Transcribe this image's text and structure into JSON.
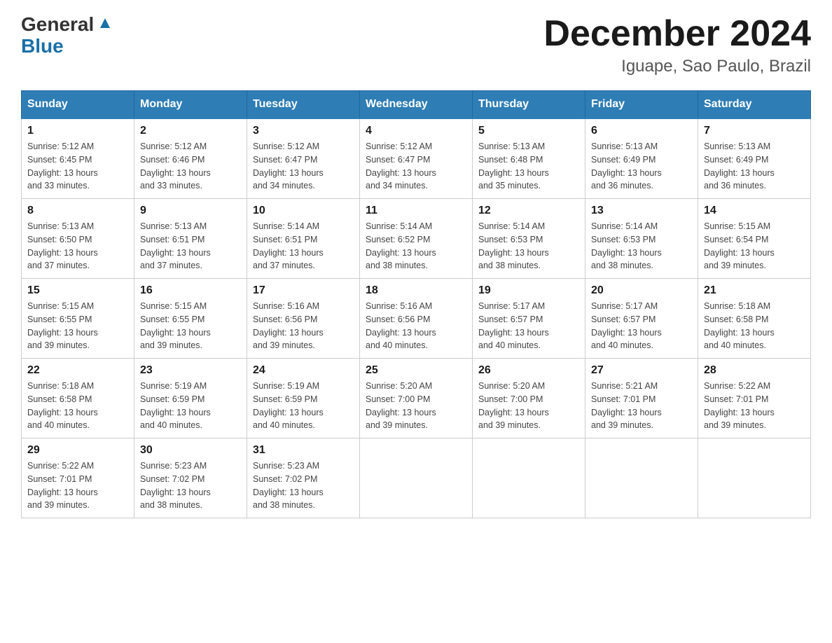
{
  "logo": {
    "line1": "General",
    "line2": "Blue"
  },
  "header": {
    "month_year": "December 2024",
    "location": "Iguape, Sao Paulo, Brazil"
  },
  "days_of_week": [
    "Sunday",
    "Monday",
    "Tuesday",
    "Wednesday",
    "Thursday",
    "Friday",
    "Saturday"
  ],
  "weeks": [
    [
      {
        "day": "1",
        "sunrise": "5:12 AM",
        "sunset": "6:45 PM",
        "daylight": "13 hours and 33 minutes."
      },
      {
        "day": "2",
        "sunrise": "5:12 AM",
        "sunset": "6:46 PM",
        "daylight": "13 hours and 33 minutes."
      },
      {
        "day": "3",
        "sunrise": "5:12 AM",
        "sunset": "6:47 PM",
        "daylight": "13 hours and 34 minutes."
      },
      {
        "day": "4",
        "sunrise": "5:12 AM",
        "sunset": "6:47 PM",
        "daylight": "13 hours and 34 minutes."
      },
      {
        "day": "5",
        "sunrise": "5:13 AM",
        "sunset": "6:48 PM",
        "daylight": "13 hours and 35 minutes."
      },
      {
        "day": "6",
        "sunrise": "5:13 AM",
        "sunset": "6:49 PM",
        "daylight": "13 hours and 36 minutes."
      },
      {
        "day": "7",
        "sunrise": "5:13 AM",
        "sunset": "6:49 PM",
        "daylight": "13 hours and 36 minutes."
      }
    ],
    [
      {
        "day": "8",
        "sunrise": "5:13 AM",
        "sunset": "6:50 PM",
        "daylight": "13 hours and 37 minutes."
      },
      {
        "day": "9",
        "sunrise": "5:13 AM",
        "sunset": "6:51 PM",
        "daylight": "13 hours and 37 minutes."
      },
      {
        "day": "10",
        "sunrise": "5:14 AM",
        "sunset": "6:51 PM",
        "daylight": "13 hours and 37 minutes."
      },
      {
        "day": "11",
        "sunrise": "5:14 AM",
        "sunset": "6:52 PM",
        "daylight": "13 hours and 38 minutes."
      },
      {
        "day": "12",
        "sunrise": "5:14 AM",
        "sunset": "6:53 PM",
        "daylight": "13 hours and 38 minutes."
      },
      {
        "day": "13",
        "sunrise": "5:14 AM",
        "sunset": "6:53 PM",
        "daylight": "13 hours and 38 minutes."
      },
      {
        "day": "14",
        "sunrise": "5:15 AM",
        "sunset": "6:54 PM",
        "daylight": "13 hours and 39 minutes."
      }
    ],
    [
      {
        "day": "15",
        "sunrise": "5:15 AM",
        "sunset": "6:55 PM",
        "daylight": "13 hours and 39 minutes."
      },
      {
        "day": "16",
        "sunrise": "5:15 AM",
        "sunset": "6:55 PM",
        "daylight": "13 hours and 39 minutes."
      },
      {
        "day": "17",
        "sunrise": "5:16 AM",
        "sunset": "6:56 PM",
        "daylight": "13 hours and 39 minutes."
      },
      {
        "day": "18",
        "sunrise": "5:16 AM",
        "sunset": "6:56 PM",
        "daylight": "13 hours and 40 minutes."
      },
      {
        "day": "19",
        "sunrise": "5:17 AM",
        "sunset": "6:57 PM",
        "daylight": "13 hours and 40 minutes."
      },
      {
        "day": "20",
        "sunrise": "5:17 AM",
        "sunset": "6:57 PM",
        "daylight": "13 hours and 40 minutes."
      },
      {
        "day": "21",
        "sunrise": "5:18 AM",
        "sunset": "6:58 PM",
        "daylight": "13 hours and 40 minutes."
      }
    ],
    [
      {
        "day": "22",
        "sunrise": "5:18 AM",
        "sunset": "6:58 PM",
        "daylight": "13 hours and 40 minutes."
      },
      {
        "day": "23",
        "sunrise": "5:19 AM",
        "sunset": "6:59 PM",
        "daylight": "13 hours and 40 minutes."
      },
      {
        "day": "24",
        "sunrise": "5:19 AM",
        "sunset": "6:59 PM",
        "daylight": "13 hours and 40 minutes."
      },
      {
        "day": "25",
        "sunrise": "5:20 AM",
        "sunset": "7:00 PM",
        "daylight": "13 hours and 39 minutes."
      },
      {
        "day": "26",
        "sunrise": "5:20 AM",
        "sunset": "7:00 PM",
        "daylight": "13 hours and 39 minutes."
      },
      {
        "day": "27",
        "sunrise": "5:21 AM",
        "sunset": "7:01 PM",
        "daylight": "13 hours and 39 minutes."
      },
      {
        "day": "28",
        "sunrise": "5:22 AM",
        "sunset": "7:01 PM",
        "daylight": "13 hours and 39 minutes."
      }
    ],
    [
      {
        "day": "29",
        "sunrise": "5:22 AM",
        "sunset": "7:01 PM",
        "daylight": "13 hours and 39 minutes."
      },
      {
        "day": "30",
        "sunrise": "5:23 AM",
        "sunset": "7:02 PM",
        "daylight": "13 hours and 38 minutes."
      },
      {
        "day": "31",
        "sunrise": "5:23 AM",
        "sunset": "7:02 PM",
        "daylight": "13 hours and 38 minutes."
      },
      null,
      null,
      null,
      null
    ]
  ],
  "labels": {
    "sunrise": "Sunrise:",
    "sunset": "Sunset:",
    "daylight": "Daylight:"
  }
}
